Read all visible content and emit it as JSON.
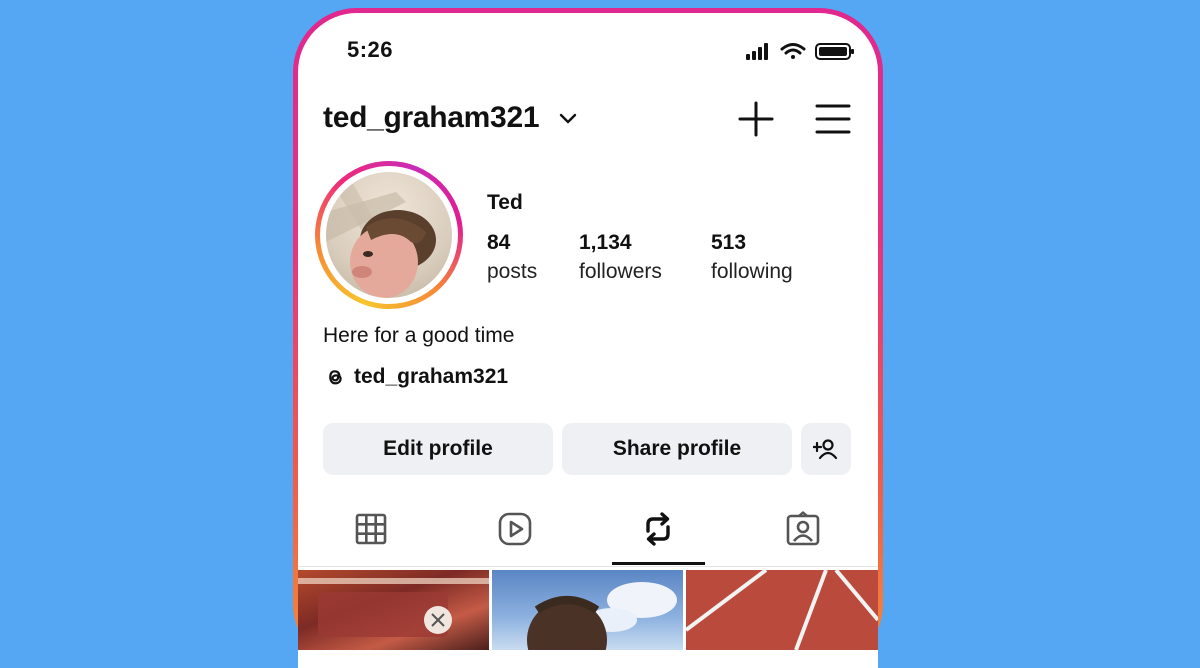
{
  "status_bar": {
    "time": "5:26"
  },
  "header": {
    "username": "ted_graham321"
  },
  "profile": {
    "display_name": "Ted",
    "stats": [
      {
        "value": "84",
        "label": "posts"
      },
      {
        "value": "1,134",
        "label": "followers"
      },
      {
        "value": "513",
        "label": "following"
      }
    ],
    "bio": "Here for a good time",
    "threads_handle": "ted_graham321"
  },
  "actions": {
    "edit_label": "Edit profile",
    "share_label": "Share profile"
  },
  "tabs": [
    {
      "icon": "grid-icon",
      "active": false
    },
    {
      "icon": "reels-icon",
      "active": false
    },
    {
      "icon": "reposts-icon",
      "active": true
    },
    {
      "icon": "tagged-icon",
      "active": false
    }
  ],
  "colors": {
    "background": "#55a6f3",
    "button_bg": "#eff0f3",
    "story_ring": [
      "#f7c52c",
      "#f58a36",
      "#ee2a7b",
      "#c92bb7"
    ]
  }
}
